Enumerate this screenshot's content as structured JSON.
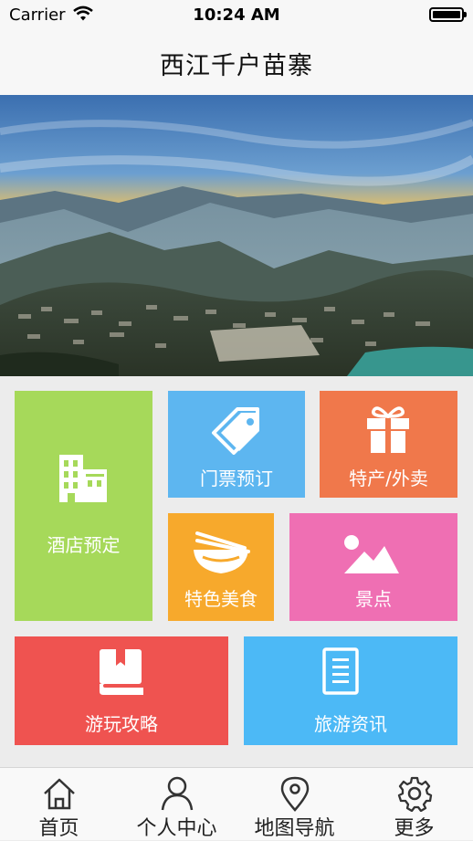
{
  "status_bar": {
    "carrier": "Carrier",
    "time": "10:24 AM"
  },
  "nav": {
    "title": "西江千户苗寨"
  },
  "banner": {
    "dots": 6,
    "active_dot": 4
  },
  "tiles": {
    "hotel": {
      "label": "酒店预定",
      "icon": "building-icon",
      "color": "#a6d95a"
    },
    "ticket": {
      "label": "门票预订",
      "icon": "ticket-tag-icon",
      "color": "#5db6f0"
    },
    "special": {
      "label": "特产/外卖",
      "icon": "gift-icon",
      "color": "#f0784b"
    },
    "food": {
      "label": "特色美食",
      "icon": "bowl-chopsticks-icon",
      "color": "#f7a92c"
    },
    "spot": {
      "label": "景点",
      "icon": "landscape-icon",
      "color": "#ef6fb3"
    },
    "guide": {
      "label": "游玩攻略",
      "icon": "book-icon",
      "color": "#ef5350"
    },
    "news": {
      "label": "旅游资讯",
      "icon": "document-icon",
      "color": "#4cb9f6"
    }
  },
  "tabs": [
    {
      "label": "首页",
      "icon": "home-icon"
    },
    {
      "label": "个人中心",
      "icon": "person-icon"
    },
    {
      "label": "地图导航",
      "icon": "map-pin-icon"
    },
    {
      "label": "更多",
      "icon": "gear-icon"
    }
  ]
}
